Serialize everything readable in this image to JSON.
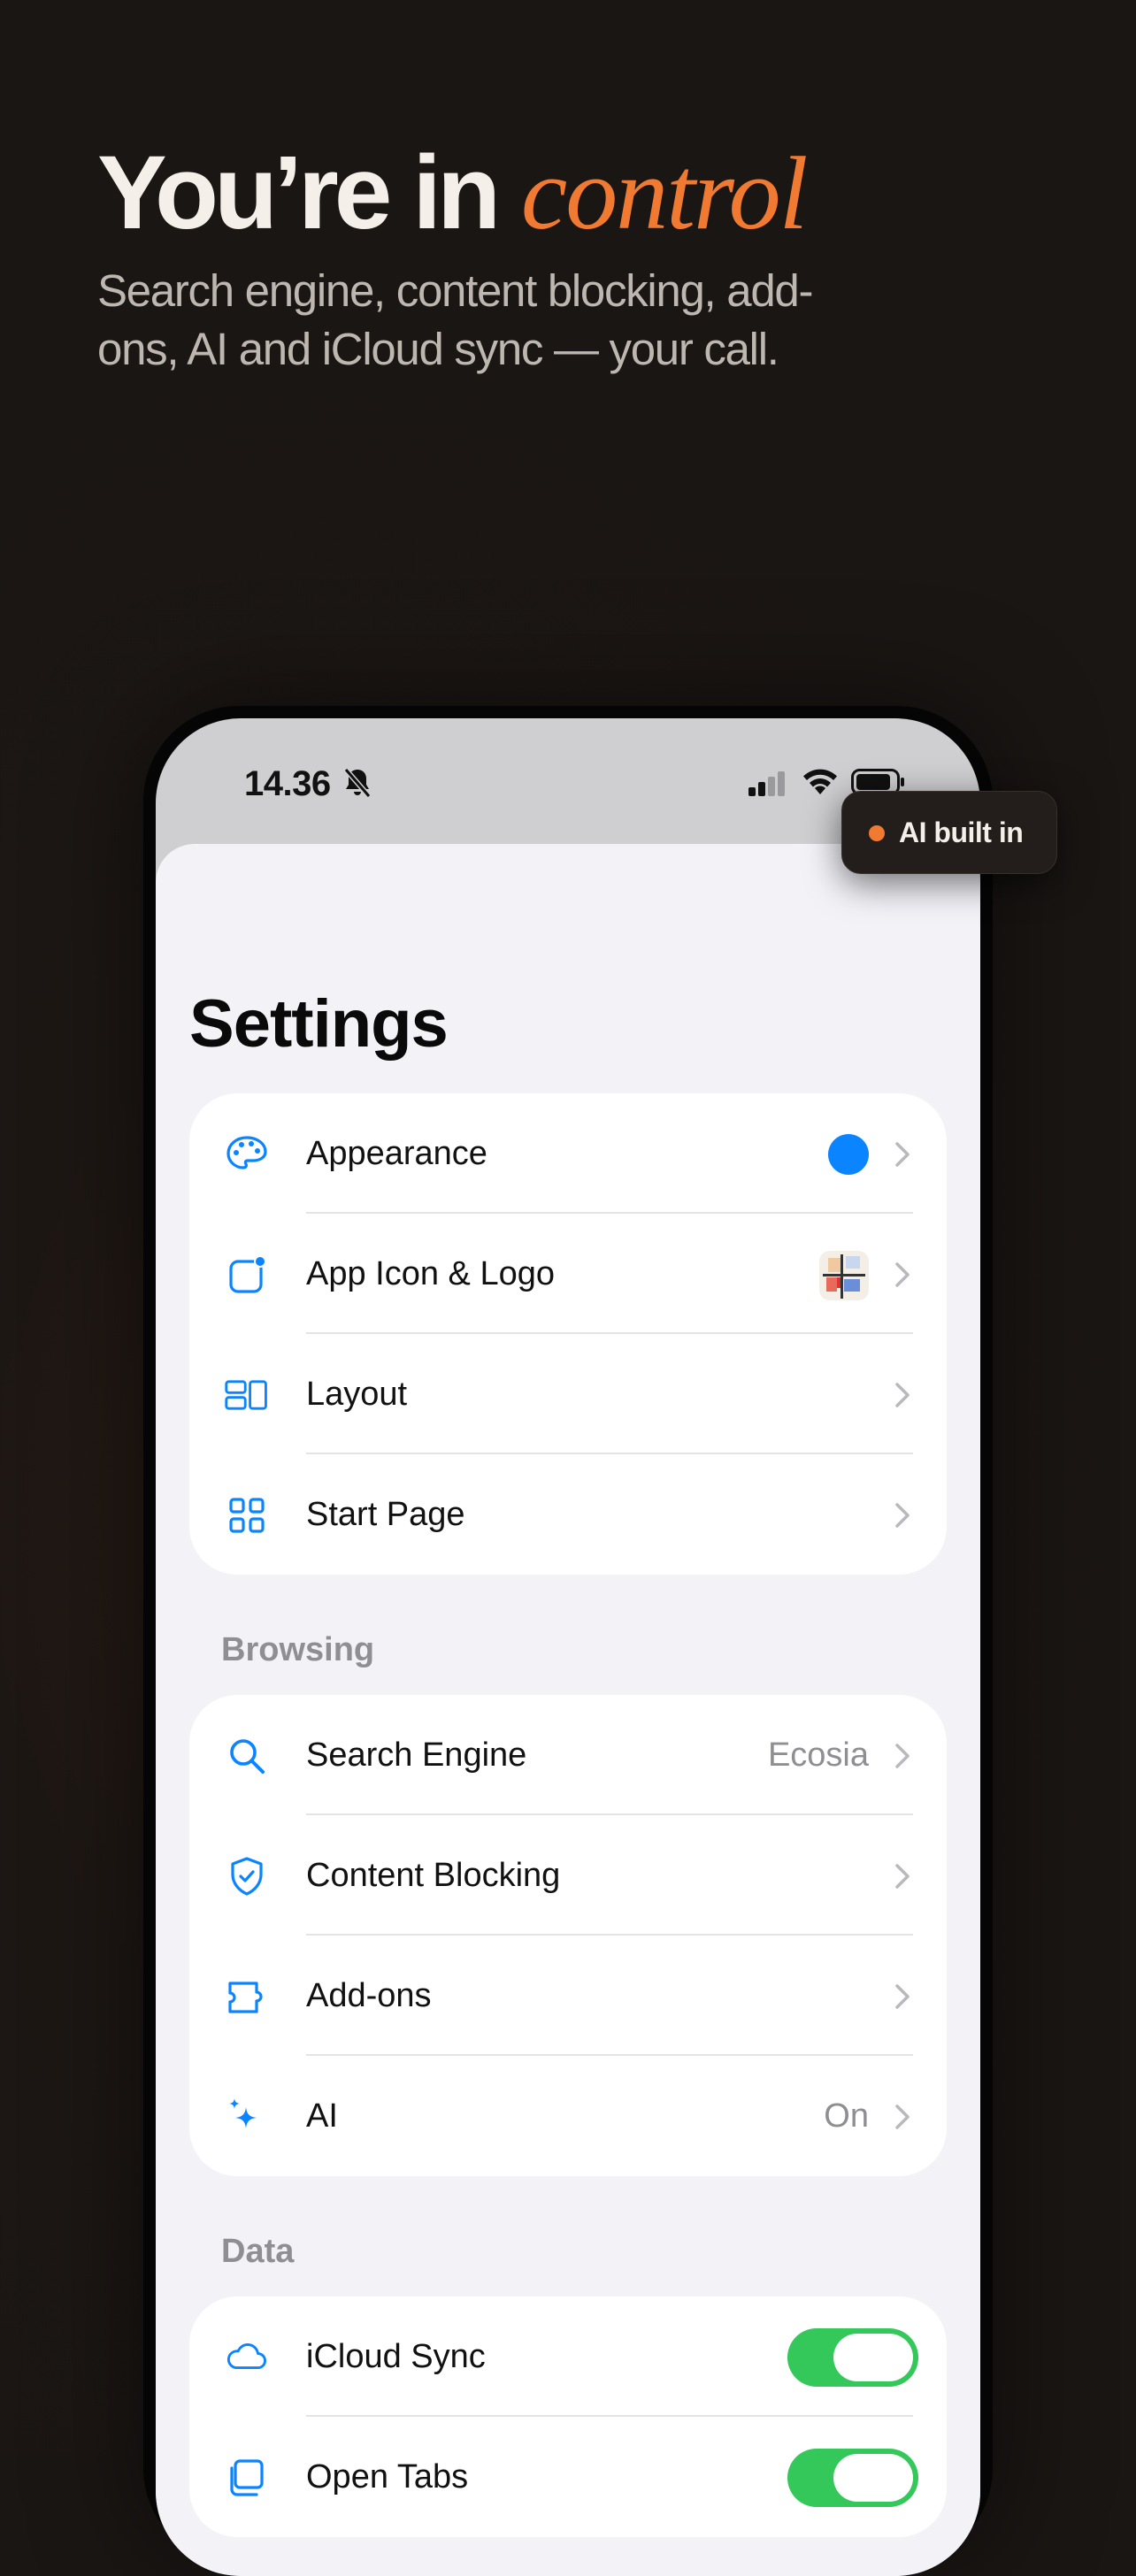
{
  "hero": {
    "headline_main": "You’re in ",
    "headline_accent": "control",
    "subtitle": "Search engine, content blocking, add-ons, AI and iCloud sync — your call."
  },
  "status_bar": {
    "time": "14.36",
    "icons": [
      "bell-slash-icon",
      "cellular-signal-icon",
      "wifi-icon",
      "battery-icon"
    ]
  },
  "badge": {
    "label": "AI built in"
  },
  "settings": {
    "title": "Settings",
    "general": [
      {
        "label": "Appearance",
        "icon": "palette-icon"
      },
      {
        "label": "App Icon & Logo",
        "icon": "app-badge-icon"
      },
      {
        "label": "Layout",
        "icon": "layout-icon"
      },
      {
        "label": "Start Page",
        "icon": "grid-icon"
      }
    ],
    "browsing_header": "Browsing",
    "browsing": [
      {
        "label": "Search Engine",
        "value": "Ecosia",
        "icon": "search-icon"
      },
      {
        "label": "Content Blocking",
        "icon": "shield-check-icon"
      },
      {
        "label": "Add-ons",
        "icon": "puzzle-icon"
      },
      {
        "label": "AI",
        "value": "On",
        "icon": "sparkles-icon"
      }
    ],
    "data_header": "Data",
    "data": [
      {
        "label": "iCloud Sync",
        "icon": "cloud-icon",
        "toggle": true
      },
      {
        "label": "Open Tabs",
        "icon": "tabs-icon",
        "toggle": true
      }
    ]
  },
  "colors": {
    "accent_orange": "#f07a32",
    "system_blue": "#0a84ff",
    "toggle_green": "#34c759",
    "appearance_swatch": "#0a84ff"
  }
}
